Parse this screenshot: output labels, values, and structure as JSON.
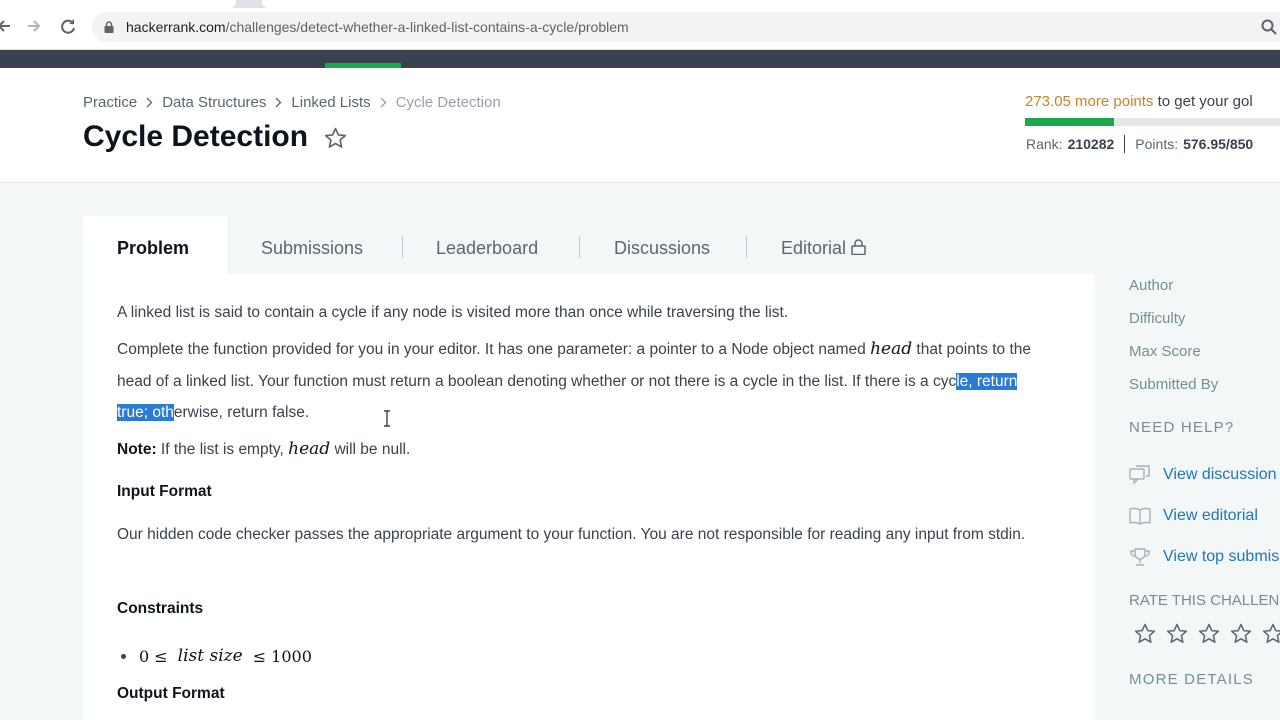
{
  "browser": {
    "url_domain": "hackerrank.com",
    "url_path": "/challenges/detect-whether-a-linked-list-contains-a-cycle/problem",
    "back_icon": "back-arrow-icon",
    "forward_icon": "forward-arrow-icon",
    "reload_icon": "reload-icon",
    "lock_icon": "lock-icon",
    "zoom_icon": "magnifier-icon"
  },
  "breadcrumb": {
    "items": [
      "Practice",
      "Data Structures",
      "Linked Lists"
    ],
    "current": "Cycle Detection"
  },
  "page": {
    "title": "Cycle Detection",
    "favorite_icon": "star-outline-icon"
  },
  "progress": {
    "points_needed": "273.05 more points",
    "points_suffix": " to get your gol",
    "fill_fraction": 0.35,
    "rank_label": "Rank:",
    "rank_value": "210282",
    "points_label": "Points:",
    "points_value": "576.95/850"
  },
  "tabs": [
    {
      "label": "Problem",
      "active": true
    },
    {
      "label": "Submissions"
    },
    {
      "label": "Leaderboard"
    },
    {
      "label": "Discussions"
    },
    {
      "label": "Editorial",
      "icon": "lock-icon"
    }
  ],
  "problem": {
    "intro": "A linked list is said to contain a cycle if any node is visited more than once while traversing the list.",
    "p2_a": "Complete the function provided for you in your editor. It has one parameter: a pointer to a Node object named ",
    "p2_math": "head",
    "p2_b": " that points to the head of a linked list. Your function must return a boolean denoting whether or not there is a cycle in the list. If there is a cyc",
    "p2_selected": "le, return true; oth",
    "p2_c": "erwise, return false.",
    "note_label": "Note:",
    "note_a": " If the list is empty, ",
    "note_math": "head",
    "note_b": " will be null.",
    "input_heading": "Input Format",
    "input_text": "Our hidden code checker passes the appropriate argument to your function. You are not responsible for reading any input from stdin.",
    "constraints_heading": "Constraints",
    "constraint_lo": "0 ≤",
    "constraint_var": "list size",
    "constraint_hi": "≤ 1000",
    "output_heading": "Output Format"
  },
  "sidebar": {
    "meta": [
      "Author",
      "Difficulty",
      "Max Score",
      "Submitted By"
    ],
    "help_heading": "NEED HELP?",
    "links": [
      {
        "label": "View discussion",
        "icon": "discussion-icon"
      },
      {
        "label": "View editorial",
        "icon": "book-icon"
      },
      {
        "label": "View top submis",
        "icon": "trophy-icon"
      }
    ],
    "rate_heading": "RATE THIS CHALLENG",
    "rate_icon": "star-outline-icon",
    "more_heading": "MORE DETAILS"
  },
  "colors": {
    "accent_green": "#1ba94c",
    "points_orange": "#c9812e",
    "link_blue": "#1f75b6",
    "selection_blue": "#2a7bd6",
    "nav_dark": "#39424e"
  }
}
